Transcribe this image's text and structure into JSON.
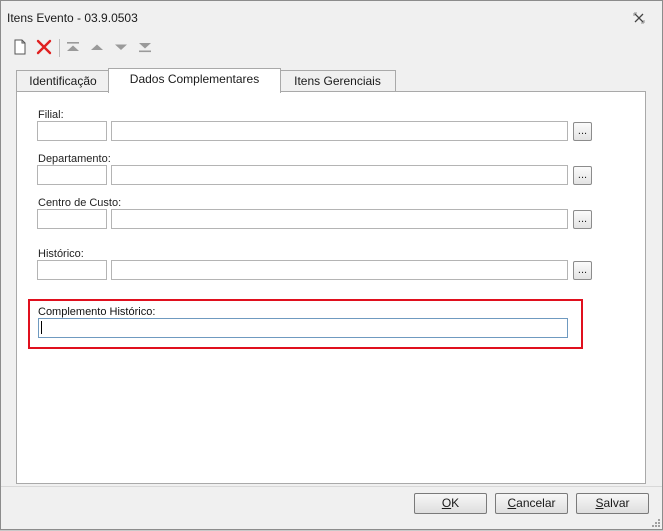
{
  "window": {
    "title": "Itens Evento - 03.9.0503"
  },
  "toolbar": {
    "items": [
      {
        "name": "new-document-icon"
      },
      {
        "name": "delete-icon",
        "color": "#e02020"
      },
      {
        "name": "move-first-icon"
      },
      {
        "name": "move-up-icon"
      },
      {
        "name": "move-down-icon"
      },
      {
        "name": "move-last-icon"
      }
    ]
  },
  "tabs": [
    {
      "label": "Identificação",
      "active": false
    },
    {
      "label": "Dados Complementares",
      "active": true
    },
    {
      "label": "Itens Gerenciais",
      "active": false
    }
  ],
  "form": {
    "filial": {
      "label": "Filial:",
      "code": "",
      "description": "",
      "lookup_label": "..."
    },
    "departamento": {
      "label": "Departamento:",
      "code": "",
      "description": "",
      "lookup_label": "..."
    },
    "centro_custo": {
      "label": "Centro de Custo:",
      "code": "",
      "description": "",
      "lookup_label": "..."
    },
    "historico": {
      "label": "Histórico:",
      "code": "",
      "description": "",
      "lookup_label": "..."
    },
    "complemento_historico": {
      "label": "Complemento Histórico:",
      "value": ""
    }
  },
  "buttons": {
    "ok": {
      "label_ul": "O",
      "label_rest": "K"
    },
    "cancelar": {
      "label_ul": "C",
      "label_rest": "ancelar"
    },
    "salvar": {
      "label_ul": "S",
      "label_rest": "alvar"
    }
  },
  "colors": {
    "highlight": "#e0101e",
    "delete": "#e02020"
  }
}
